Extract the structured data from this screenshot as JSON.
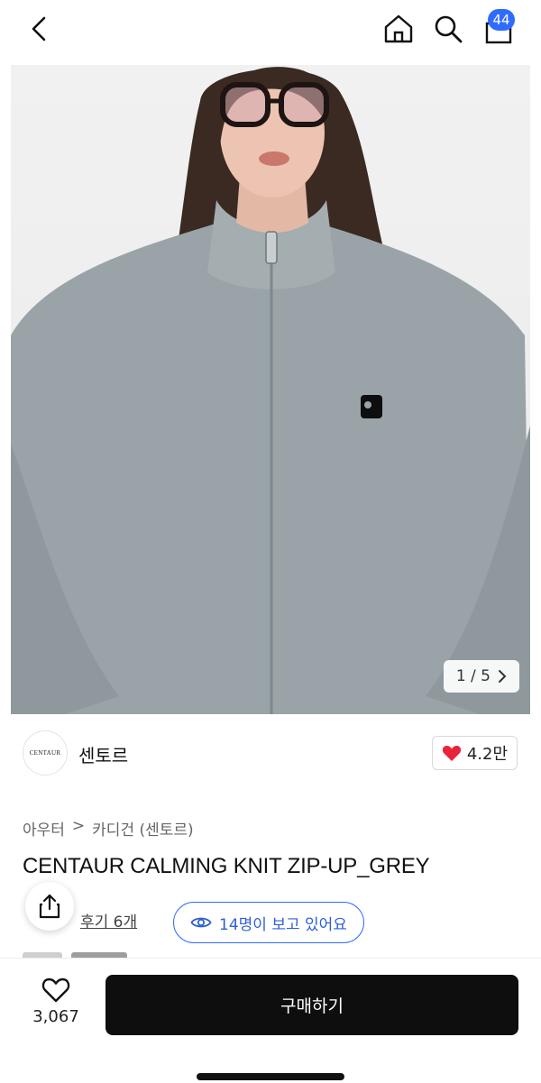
{
  "header": {
    "cart_badge": "44"
  },
  "gallery": {
    "counter": "1 / 5"
  },
  "brand": {
    "logo_text": "CENTAUR",
    "name": "센토르",
    "likes": "4.2만"
  },
  "product": {
    "category_1": "아우터",
    "category_sep": ">",
    "category_2": "카디건 (센토르)",
    "title": "CENTAUR CALMING KNIT ZIP-UP_GREY",
    "reviews": "후기 6개",
    "viewers": "14명이 보고 있어요"
  },
  "bottom": {
    "wish_count": "3,067",
    "buy_label": "구매하기"
  },
  "colors": {
    "accent": "#2f6bff",
    "heart": "#e8233a",
    "buy_button": "#0e0e0e",
    "sweater": "#9aa4a8"
  },
  "icons": [
    "back-icon",
    "home-icon",
    "search-icon",
    "cart-icon",
    "chevron-right-icon",
    "heart-filled-icon",
    "share-icon",
    "eye-icon",
    "heart-outline-icon"
  ]
}
